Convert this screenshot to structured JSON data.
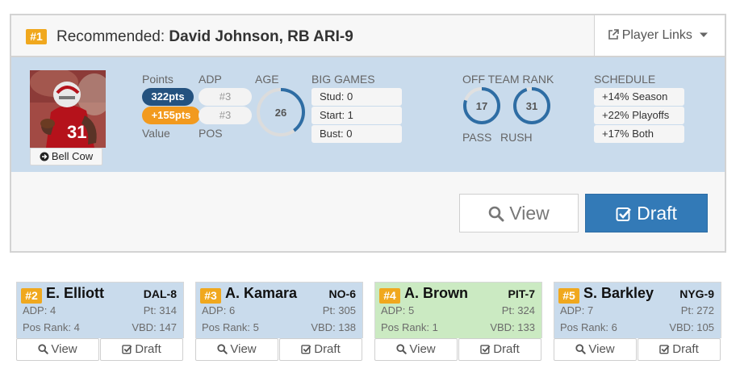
{
  "recommended": {
    "rank_badge": "#1",
    "prefix": "Recommended: ",
    "player": "David Johnson, RB ARI-9",
    "player_links_label": "Player Links",
    "bell_cow_label": "Bell Cow",
    "labels": {
      "points": "Points",
      "value": "Value",
      "adp": "ADP",
      "pos": "POS",
      "age": "AGE",
      "big_games": "BIG GAMES",
      "off_team_rank": "OFF TEAM RANK",
      "pass": "PASS",
      "rush": "RUSH",
      "schedule": "SCHEDULE"
    },
    "points": "322pts",
    "value": "+155pts",
    "adp": "#3",
    "pos": "#3",
    "age": "26",
    "age_gauge_fraction": 0.4,
    "big_games": [
      "Stud: 0",
      "Start: 1",
      "Bust: 0"
    ],
    "pass_rank": "17",
    "pass_gauge_fraction": 0.8,
    "rush_rank": "31",
    "rush_gauge_fraction": 0.95,
    "schedule": [
      "+14% Season",
      "+22% Playoffs",
      "+17% Both"
    ],
    "view_label": "View",
    "draft_label": "Draft"
  },
  "players": [
    {
      "rank": "#2",
      "name": "E. Elliott",
      "team": "DAL-8",
      "adp": "ADP: 4",
      "pt": "Pt: 314",
      "pos_rank": "Pos Rank: 4",
      "vbd": "VBD: 147",
      "view": "View",
      "draft": "Draft",
      "highlight": false
    },
    {
      "rank": "#3",
      "name": "A. Kamara",
      "team": "NO-6",
      "adp": "ADP: 6",
      "pt": "Pt: 305",
      "pos_rank": "Pos Rank: 5",
      "vbd": "VBD: 138",
      "view": "View",
      "draft": "Draft",
      "highlight": false
    },
    {
      "rank": "#4",
      "name": "A. Brown",
      "team": "PIT-7",
      "adp": "ADP: 5",
      "pt": "Pt: 324",
      "pos_rank": "Pos Rank: 1",
      "vbd": "VBD: 133",
      "view": "View",
      "draft": "Draft",
      "highlight": true
    },
    {
      "rank": "#5",
      "name": "S. Barkley",
      "team": "NYG-9",
      "adp": "ADP: 7",
      "pt": "Pt: 272",
      "pos_rank": "Pos Rank: 6",
      "vbd": "VBD: 105",
      "view": "View",
      "draft": "Draft",
      "highlight": false
    }
  ],
  "colors": {
    "rank_badge": "#f0a81e",
    "panel_blue": "#c9dbec",
    "panel_green": "#cbeac2",
    "points_pill": "#24527f",
    "value_pill": "#f29a1e",
    "draft_button": "#337ab7",
    "gauge": "#2e6da4"
  },
  "icons": {
    "player_links": "external-link-icon",
    "bell_cow": "arrow-circle-right-icon",
    "view": "search-icon",
    "draft": "check-square-icon",
    "dropdown": "caret-down-icon"
  }
}
